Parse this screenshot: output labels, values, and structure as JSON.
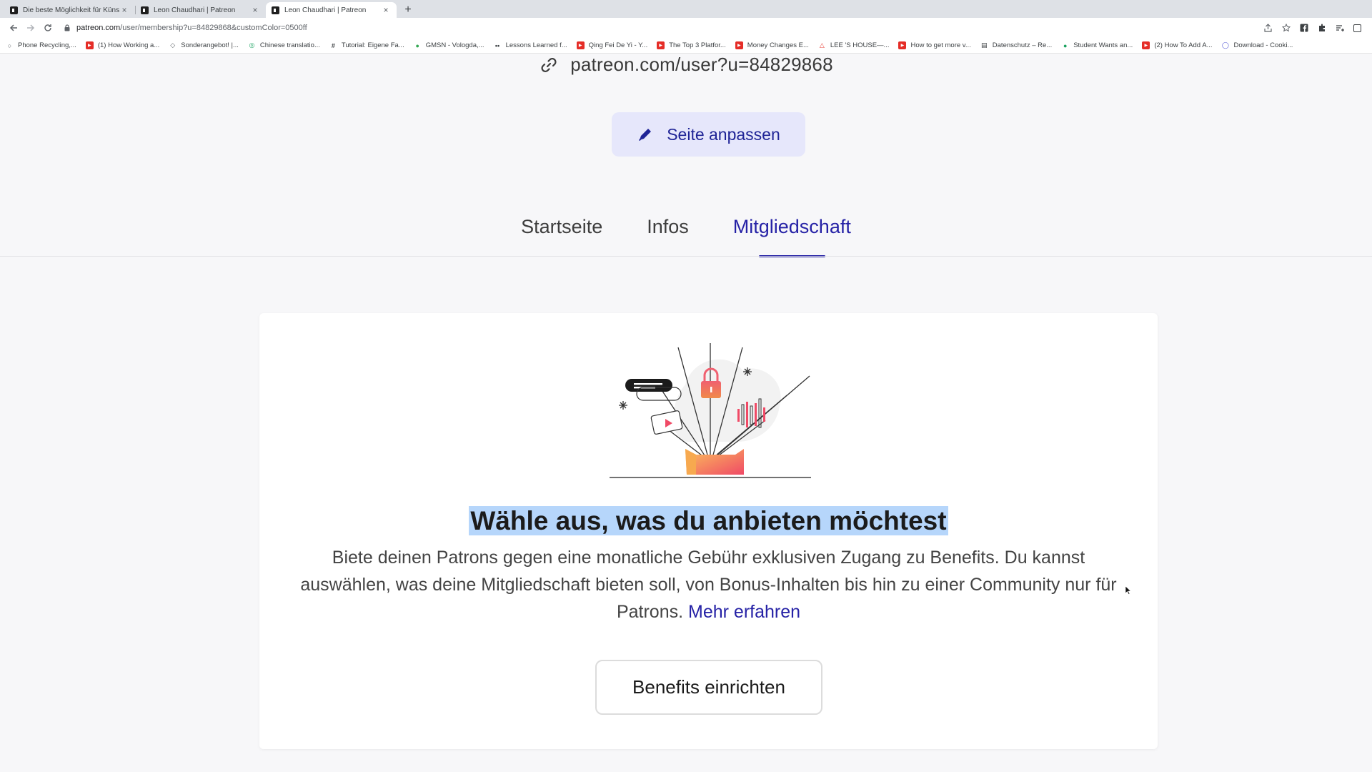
{
  "browser": {
    "tabs": [
      {
        "title": "Die beste Möglichkeit für Küns",
        "active": false
      },
      {
        "title": "Leon Chaudhari | Patreon",
        "active": false
      },
      {
        "title": "Leon Chaudhari | Patreon",
        "active": true
      }
    ],
    "new_tab_label": "+",
    "close_glyph": "×",
    "url_host": "patreon.com",
    "url_path": "/user/membership?u=84829868&customColor=0500ff",
    "bookmarks": [
      {
        "label": "Phone Recycling,...",
        "icon": "search-icon",
        "color": "#5f6368"
      },
      {
        "label": "(1) How Working a...",
        "icon": "youtube-icon",
        "color": "#e52d27"
      },
      {
        "label": "Sonderangebot! |...",
        "icon": "tag-icon",
        "color": "#5f6368"
      },
      {
        "label": "Chinese translatio...",
        "icon": "globe-icon",
        "color": "#1aa260"
      },
      {
        "label": "Tutorial: Eigene Fa...",
        "icon": "hash-icon",
        "color": "#3c4043"
      },
      {
        "label": "GMSN - Vologda,...",
        "icon": "leaf-icon",
        "color": "#34a853"
      },
      {
        "label": "Lessons Learned f...",
        "icon": "medium-icon",
        "color": "#3c4043"
      },
      {
        "label": "Qing Fei De Yi - Y...",
        "icon": "youtube-icon",
        "color": "#e52d27"
      },
      {
        "label": "The Top 3 Platfor...",
        "icon": "youtube-icon",
        "color": "#e52d27"
      },
      {
        "label": "Money Changes E...",
        "icon": "youtube-icon",
        "color": "#e52d27"
      },
      {
        "label": "LEE 'S HOUSE—...",
        "icon": "house-icon",
        "color": "#e8453c"
      },
      {
        "label": "How to get more v...",
        "icon": "youtube-icon",
        "color": "#e52d27"
      },
      {
        "label": "Datenschutz – Re...",
        "icon": "doc-icon",
        "color": "#3c4043"
      },
      {
        "label": "Student Wants an...",
        "icon": "circle-icon",
        "color": "#1aa260"
      },
      {
        "label": "(2) How To Add A...",
        "icon": "youtube-icon",
        "color": "#e52d27"
      },
      {
        "label": "Download - Cooki...",
        "icon": "ring-icon",
        "color": "#5b5fd6"
      }
    ]
  },
  "profile": {
    "public_url": "patreon.com/user?u=84829868",
    "customize_label": "Seite anpassen"
  },
  "nav": {
    "tabs": [
      {
        "label": "Startseite",
        "active": false
      },
      {
        "label": "Infos",
        "active": false
      },
      {
        "label": "Mitgliedschaft",
        "active": true
      }
    ]
  },
  "membership": {
    "title": "Wähle aus, was du anbieten möchtest",
    "description": "Biete deinen Patrons gegen eine monatliche Gebühr exklusiven Zugang zu Benefits. Du kannst auswählen, was deine Mitgliedschaft bieten soll, von Bonus-Inhalten bis hin zu einer Community nur für Patrons.",
    "learn_more": "Mehr erfahren",
    "cta": "Benefits einrichten"
  },
  "colors": {
    "accent": "#2622a6",
    "button_bg": "#e6e7fb",
    "highlight": "#b6d6fb"
  }
}
